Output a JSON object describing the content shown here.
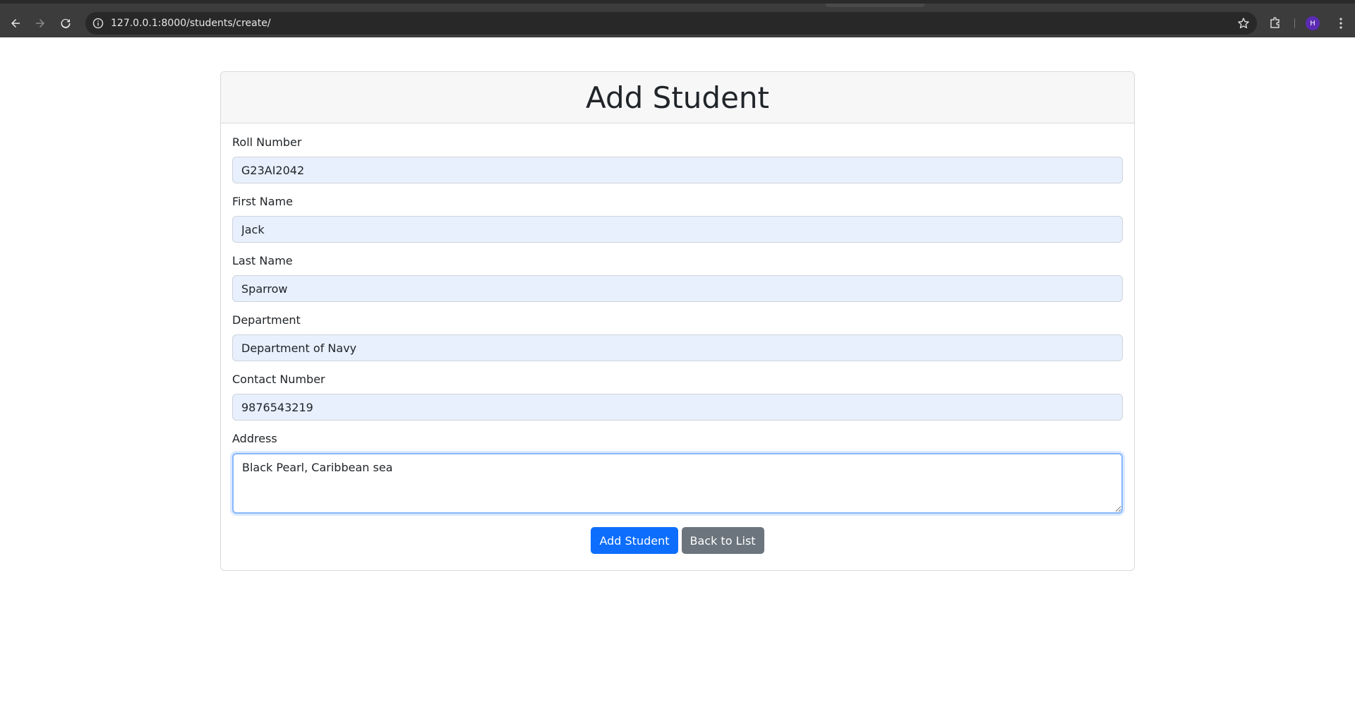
{
  "browser": {
    "url": "127.0.0.1:8000/students/create/",
    "avatar_letter": "H"
  },
  "page": {
    "title": "Add Student"
  },
  "form": {
    "fields": [
      {
        "label": "Roll Number",
        "value": "G23AI2042"
      },
      {
        "label": "First Name",
        "value": "Jack"
      },
      {
        "label": "Last Name",
        "value": "Sparrow"
      },
      {
        "label": "Department",
        "value": "Department of Navy"
      },
      {
        "label": "Contact Number",
        "value": "9876543219"
      }
    ],
    "address": {
      "label": "Address",
      "value": "Black Pearl, Caribbean sea"
    },
    "submit_label": "Add Student",
    "back_label": "Back to List"
  },
  "colors": {
    "primary": "#0d6efd",
    "secondary": "#6c757d",
    "autofill_bg": "#e8f0fe"
  }
}
